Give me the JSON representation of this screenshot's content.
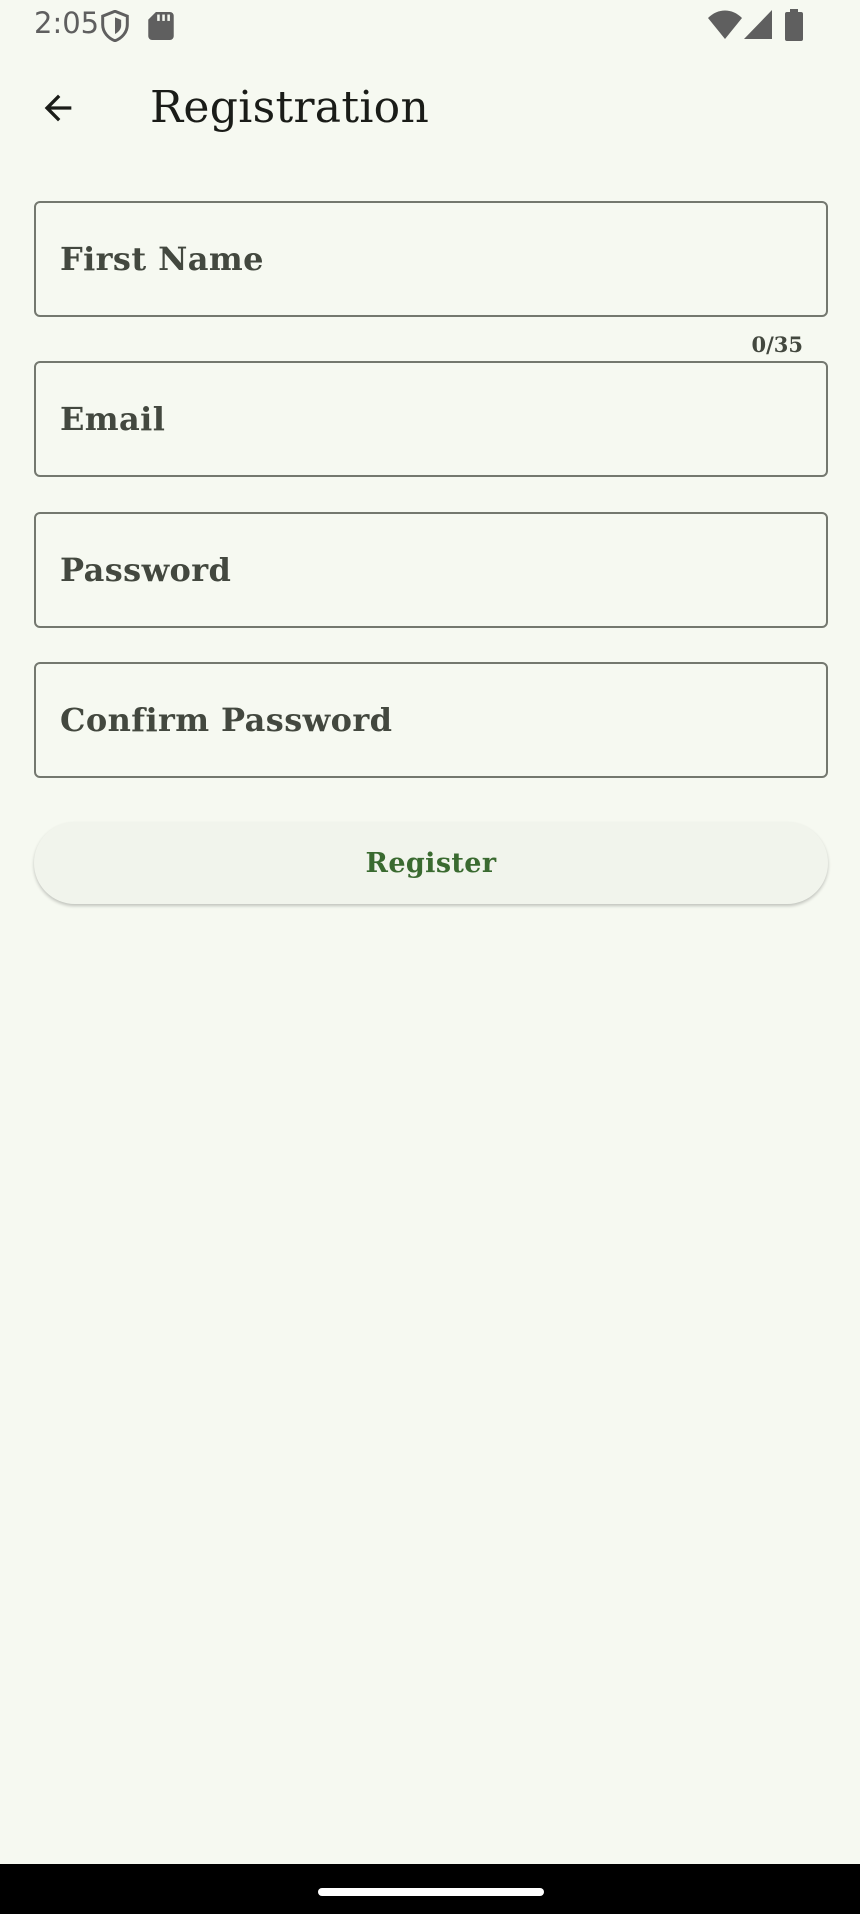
{
  "status_bar": {
    "time": "2:05",
    "icons": [
      "shield-icon",
      "sd-card-icon",
      "wifi-icon",
      "cell-signal-icon",
      "battery-icon"
    ]
  },
  "app_bar": {
    "back_icon": "arrow-back-icon",
    "title": "Registration"
  },
  "form": {
    "first_name": {
      "placeholder": "First Name",
      "value": "",
      "counter": "0/35"
    },
    "email": {
      "placeholder": "Email",
      "value": ""
    },
    "password": {
      "placeholder": "Password",
      "value": ""
    },
    "confirm_password": {
      "placeholder": "Confirm Password",
      "value": ""
    },
    "register_label": "Register"
  },
  "colors": {
    "background": "#f6f9f1",
    "outline": "#74786f",
    "accent": "#3a6a30",
    "text": "#1a1c18"
  }
}
